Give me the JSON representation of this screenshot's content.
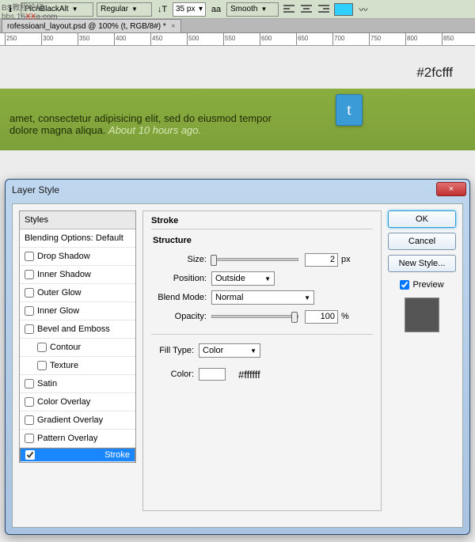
{
  "watermark_a": "BS教程论坛",
  "watermark_b": "bbs.16",
  "watermark_c": "a.com",
  "watermark_x": "XX",
  "topbar": {
    "font": "PicnBlackAlt",
    "weight": "Regular",
    "size": "35 px",
    "aa_label": "aa",
    "aa": "Smooth",
    "size_prefix": "T",
    "swatch_color": "#2fcfff",
    "color_label": "#2fcfff"
  },
  "doc_tab": "rofessioanl_layout.psd @ 100% (t, RGB/8#) *",
  "ruler_ticks": [
    250,
    300,
    350,
    400,
    450,
    500,
    550,
    600,
    650,
    700,
    750,
    800,
    850
  ],
  "banner": {
    "line1": "amet, consectetur adipisicing elit, sed do eiusmod tempor",
    "line2a": "dolore magna aliqua.  ",
    "line2b": "About 10 hours ago.",
    "twitter_glyph": "t"
  },
  "dialog": {
    "title": "Layer Style",
    "close": "×",
    "styles_header": "Styles",
    "blending": "Blending Options: Default",
    "items": [
      {
        "label": "Drop Shadow",
        "checked": false
      },
      {
        "label": "Inner Shadow",
        "checked": false
      },
      {
        "label": "Outer Glow",
        "checked": false
      },
      {
        "label": "Inner Glow",
        "checked": false
      },
      {
        "label": "Bevel and Emboss",
        "checked": false
      },
      {
        "label": "Contour",
        "checked": false,
        "indent": true
      },
      {
        "label": "Texture",
        "checked": false,
        "indent": true
      },
      {
        "label": "Satin",
        "checked": false
      },
      {
        "label": "Color Overlay",
        "checked": false
      },
      {
        "label": "Gradient Overlay",
        "checked": false
      },
      {
        "label": "Pattern Overlay",
        "checked": false
      },
      {
        "label": "Stroke",
        "checked": true,
        "selected": true
      }
    ],
    "panel": {
      "title": "Stroke",
      "group1": "Structure",
      "size_label": "Size:",
      "size_val": "2",
      "size_suffix": "px",
      "position_label": "Position:",
      "position_val": "Outside",
      "blend_label": "Blend Mode:",
      "blend_val": "Normal",
      "opacity_label": "Opacity:",
      "opacity_val": "100",
      "opacity_suffix": "%",
      "filltype_label": "Fill Type:",
      "filltype_val": "Color",
      "color_label": "Color:",
      "color_hex": "#ffffff"
    },
    "buttons": {
      "ok": "OK",
      "cancel": "Cancel",
      "newstyle": "New Style...",
      "preview": "Preview"
    }
  }
}
